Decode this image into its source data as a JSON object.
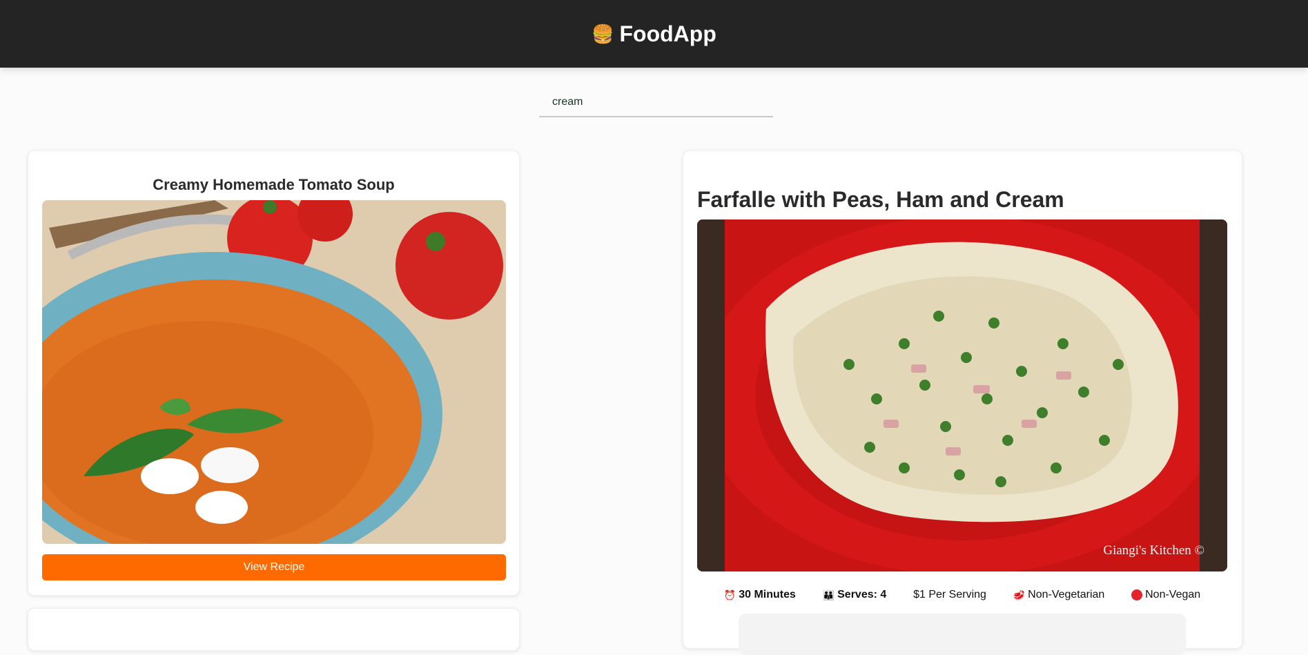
{
  "header": {
    "logo_icon": "🍔",
    "title": "FoodApp",
    "background": "#242424"
  },
  "search": {
    "value": "cream",
    "placeholder": ""
  },
  "results": [
    {
      "title": "Creamy Homemade Tomato Soup",
      "image_icon": "tomato-soup-photo",
      "button_label": "View Recipe",
      "button_color": "#ff6a00"
    }
  ],
  "detail": {
    "title": "Farfalle with Peas, Ham and Cream",
    "image_icon": "farfalle-pasta-photo",
    "watermark": "Giangi's Kitchen ©",
    "time": {
      "icon": "alarm-clock-icon",
      "value": "30 Minutes"
    },
    "serves": {
      "icon": "people-icon",
      "value": "Serves: 4"
    },
    "price": "$1 Per Serving",
    "diet": {
      "icon": "meat-icon",
      "label": "Non-Vegetarian"
    },
    "vegan": {
      "icon": "red-circle-icon",
      "label": "Non-Vegan",
      "color": "#e3242b"
    }
  }
}
